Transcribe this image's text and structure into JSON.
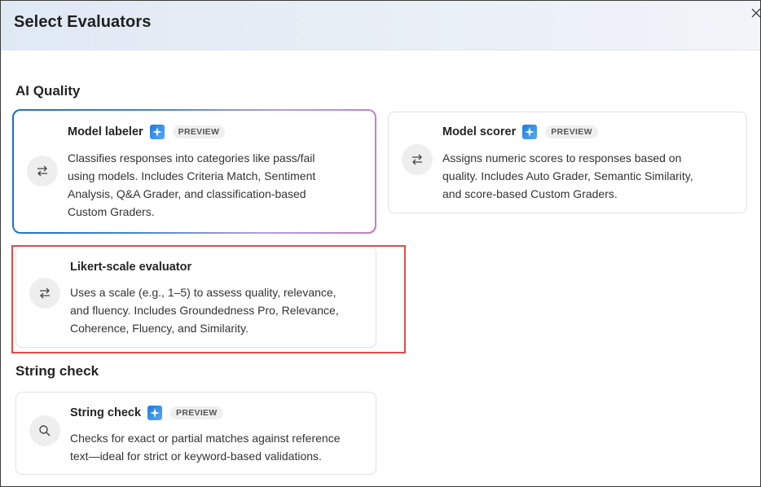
{
  "dialog": {
    "title": "Select Evaluators",
    "close_icon": "close-icon"
  },
  "sections": {
    "ai_quality": "AI Quality",
    "string_check": "String check"
  },
  "cards": {
    "model_labeler": {
      "title": "Model labeler",
      "badge": "PREVIEW",
      "icon": "swap-arrows-icon",
      "description_lines": [
        "Classifies responses into categories like pass/fail",
        "using models. Includes Criteria Match, Sentiment",
        "Analysis, Q&A Grader, and classification-based",
        "Custom Graders."
      ]
    },
    "model_scorer": {
      "title": "Model scorer",
      "badge": "PREVIEW",
      "icon": "swap-arrows-icon",
      "description_lines": [
        "Assigns numeric scores to responses based on",
        "quality. Includes Auto Grader, Semantic Similarity,",
        "and score-based Custom Graders."
      ]
    },
    "likert": {
      "title": "Likert-scale evaluator",
      "icon": "swap-arrows-icon",
      "description_lines": [
        "Uses a scale (e.g., 1–5) to assess quality, relevance,",
        "and fluency. Includes Groundedness Pro, Relevance,",
        "Coherence, Fluency, and Similarity."
      ]
    },
    "string_check": {
      "title": "String check",
      "badge": "PREVIEW",
      "icon": "search-icon",
      "description_lines": [
        "Checks for exact or partial matches against reference",
        "text—ideal for strict or keyword-based validations."
      ]
    }
  },
  "colors": {
    "highlight": "#e04a4a",
    "selected_gradient_start": "#1570c8",
    "selected_gradient_end": "#c47ac4",
    "sparkle": "#1e7de0"
  }
}
